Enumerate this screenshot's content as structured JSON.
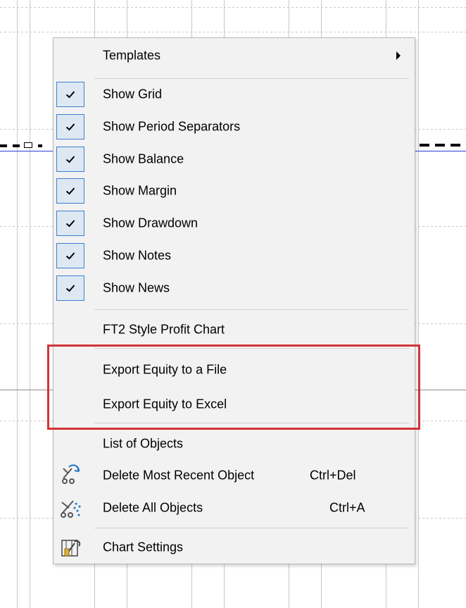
{
  "colors": {
    "checkbox_fill": "#dde8f3",
    "checkbox_border": "#3e7fd1",
    "highlight": "#d13438"
  },
  "menu": {
    "templates": {
      "label": "Templates",
      "icon": "chevron-right-icon"
    },
    "toggles": [
      {
        "label": "Show Grid",
        "checked": true
      },
      {
        "label": "Show Period Separators",
        "checked": true
      },
      {
        "label": "Show Balance",
        "checked": true
      },
      {
        "label": "Show Margin",
        "checked": true
      },
      {
        "label": "Show Drawdown",
        "checked": true
      },
      {
        "label": "Show Notes",
        "checked": true
      },
      {
        "label": "Show News",
        "checked": true
      }
    ],
    "ft2_style": {
      "label": "FT2 Style Profit Chart"
    },
    "export_file": {
      "label": "Export Equity to a File"
    },
    "export_excel": {
      "label": "Export Equity to Excel"
    },
    "list_objects": {
      "label": "List of Objects"
    },
    "delete_recent": {
      "label": "Delete Most Recent Object",
      "shortcut": "Ctrl+Del",
      "icon": "delete-recent-object-icon"
    },
    "delete_all": {
      "label": "Delete All Objects",
      "shortcut": "Ctrl+A",
      "icon": "delete-all-objects-icon"
    },
    "chart_settings": {
      "label": "Chart Settings",
      "icon": "chart-settings-icon"
    }
  }
}
